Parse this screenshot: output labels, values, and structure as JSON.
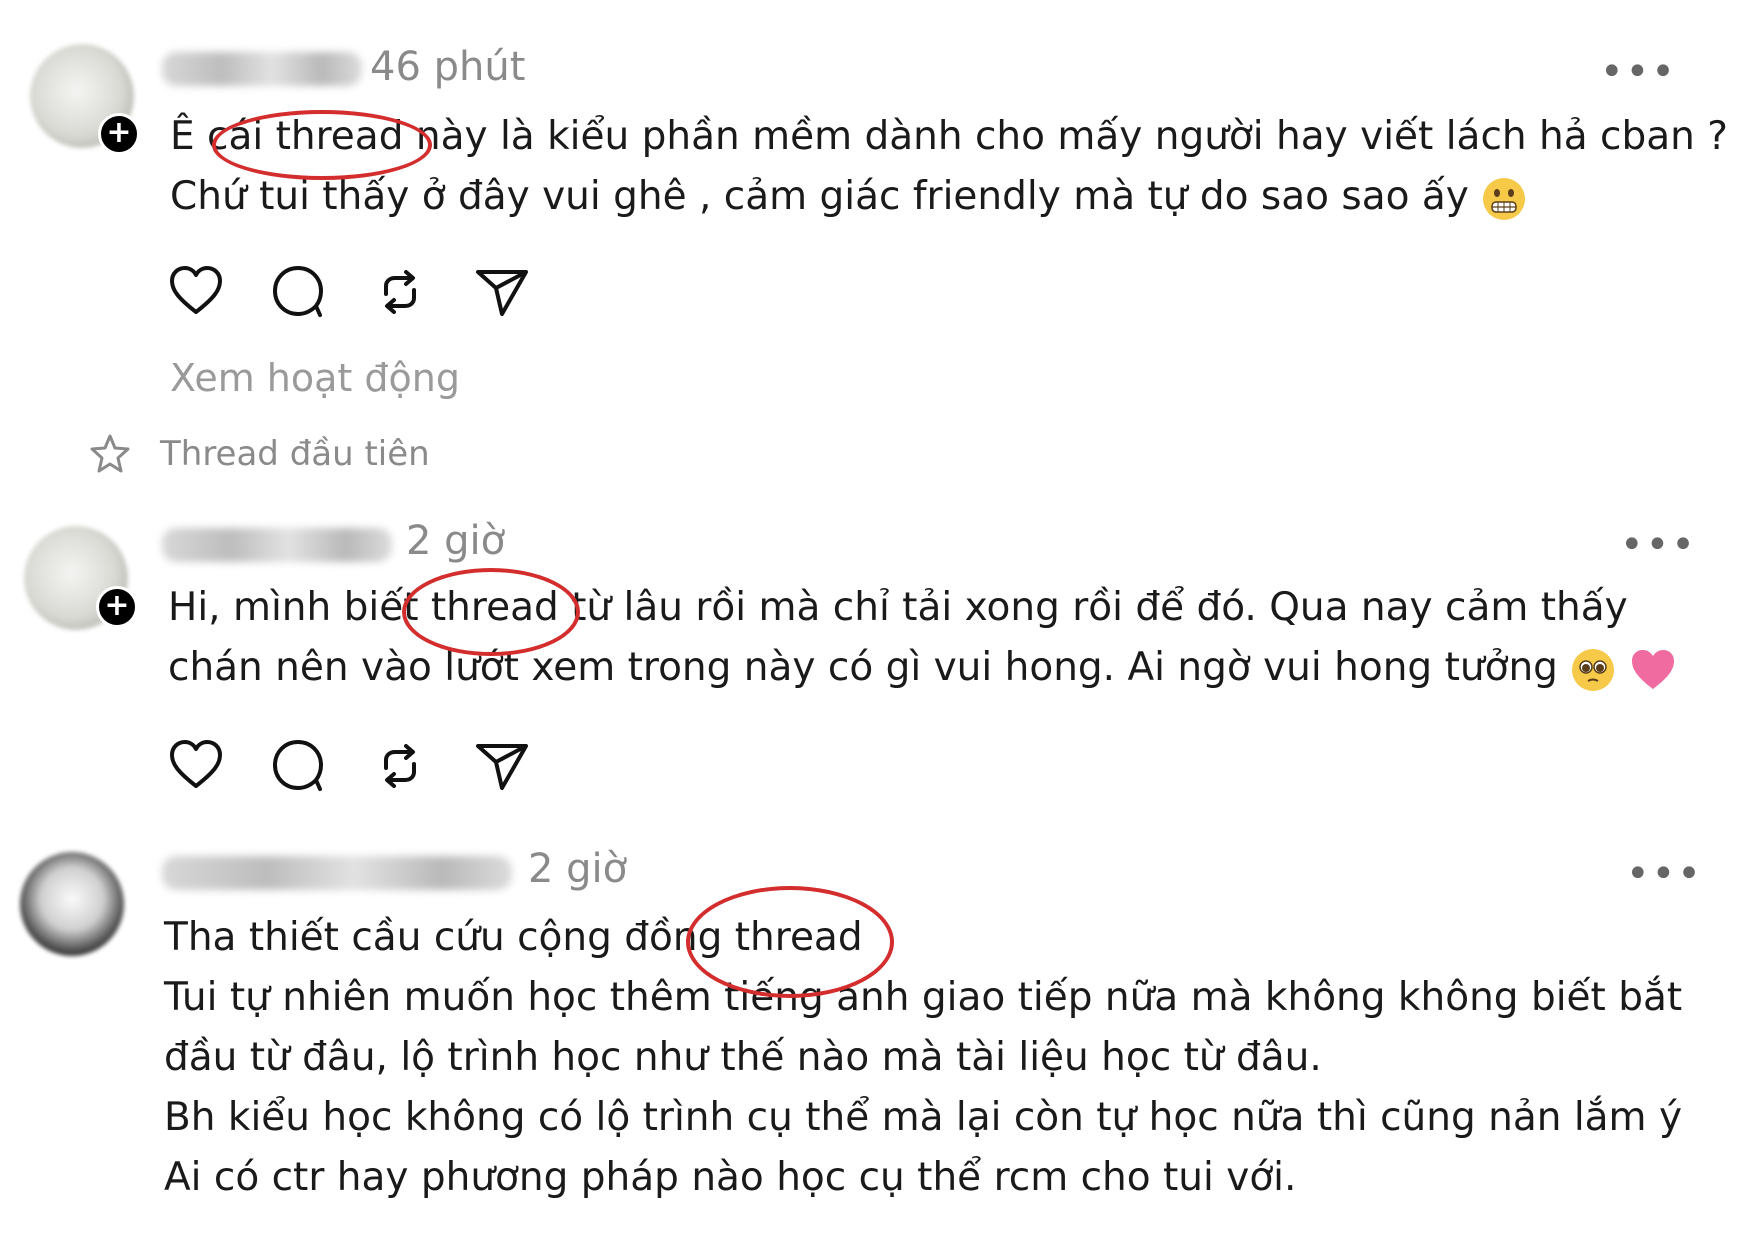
{
  "posts": [
    {
      "time": "46 phút",
      "lines": [
        "Ê cái thread này là kiểu phần mềm dành cho mấy người hay viết lách hả cban ?",
        "Chứ tui thấy ở đây vui ghê , cảm giác friendly mà tự do sao sao ấy"
      ],
      "activity": "Xem hoạt động",
      "badge": "Thread đầu tiên"
    },
    {
      "time": "2 giờ",
      "lines": [
        "Hi, mình biết thread từ lâu rồi mà chỉ tải xong rồi để đó. Qua nay cảm thấy",
        "chán nên vào lướt xem trong này có gì vui hong. Ai ngờ vui hong tưởng"
      ]
    },
    {
      "time": "2 giờ",
      "lines": [
        "Tha thiết cầu cứu cộng đồng thread",
        "Tui tự nhiên muốn học thêm tiếng anh giao tiếp nữa mà không không biết bắt",
        "đầu từ đâu, lộ trình học như thế nào mà tài liệu học từ đâu.",
        "Bh kiểu học không có lộ trình cụ thể mà lại còn tự học nữa thì cũng nản lắm ý",
        "Ai có ctr hay phương pháp nào học cụ thể rcm cho tui với."
      ]
    }
  ],
  "more_label": "•••",
  "plus_label": "+",
  "icons": [
    "heart-icon",
    "comment-icon",
    "repost-icon",
    "share-icon",
    "star-icon",
    "grimace-emoji",
    "pleading-emoji",
    "pink-heart-emoji"
  ],
  "colors": {
    "highlight_ring": "#d32d2d",
    "muted": "#8a8a8a"
  }
}
